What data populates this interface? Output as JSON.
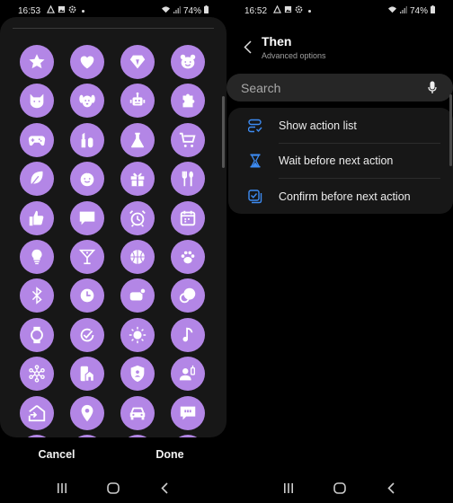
{
  "left_screen": {
    "status": {
      "time": "16:53",
      "battery": "74%"
    },
    "icons": [
      "star",
      "heart",
      "diamond",
      "bear",
      "cat",
      "dog",
      "robot",
      "puzzle",
      "gamepad",
      "cosmetics",
      "flask",
      "cart",
      "leaf",
      "baby",
      "gift",
      "cutlery",
      "thumbs-up",
      "chat-bubble",
      "alarm-clock",
      "calendar",
      "lightbulb",
      "cocktail",
      "basketball",
      "paw",
      "bluetooth",
      "clock",
      "toggle-notification",
      "earbuds",
      "smartwatch",
      "refresh-check",
      "sun",
      "music-note",
      "network-hub",
      "smart-home",
      "security-shield",
      "person-remote",
      "home-enter",
      "location-pin",
      "car",
      "quote-bubble"
    ],
    "actions": {
      "cancel": "Cancel",
      "done": "Done"
    }
  },
  "right_screen": {
    "status": {
      "time": "16:52",
      "battery": "74%"
    },
    "header": {
      "title": "Then",
      "subtitle": "Advanced options"
    },
    "search": {
      "placeholder": "Search"
    },
    "menu": [
      {
        "label": "Show action list",
        "icon": "action-list"
      },
      {
        "label": "Wait before next action",
        "icon": "hourglass"
      },
      {
        "label": "Confirm before next action",
        "icon": "confirm-check"
      }
    ]
  },
  "colors": {
    "icon_bg": "#b386e6",
    "accent_blue": "#3d8bf2"
  }
}
